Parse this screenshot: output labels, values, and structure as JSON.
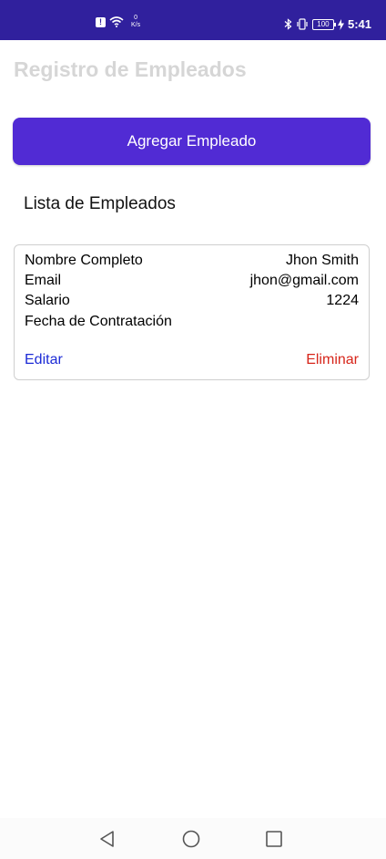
{
  "status_bar": {
    "net_speed_value": "0",
    "net_speed_unit": "K/s",
    "battery": "100",
    "time": "5:41"
  },
  "page": {
    "title": "Registro de Empleados",
    "add_button_label": "Agregar Empleado",
    "list_title": "Lista de Empleados"
  },
  "employee": {
    "name_label": "Nombre Completo",
    "name_value": "Jhon Smith",
    "email_label": "Email",
    "email_value": "jhon@gmail.com",
    "salary_label": "Salario",
    "salary_value": "1224",
    "hire_date_label": "Fecha de Contratación",
    "hire_date_value": "",
    "edit_label": "Editar",
    "delete_label": "Eliminar"
  },
  "colors": {
    "status_bar": "#30209d",
    "primary_button": "#512bd4",
    "edit_link": "#1c2bd6",
    "delete_link": "#d7261b",
    "title": "#d6d6d6"
  },
  "icons": {
    "status_left": [
      "notification-icon",
      "wifi-icon"
    ],
    "status_right": [
      "bluetooth-icon",
      "vibrate-icon",
      "battery-icon",
      "charging-icon"
    ],
    "nav": [
      "back-icon",
      "home-icon",
      "recents-icon"
    ]
  }
}
